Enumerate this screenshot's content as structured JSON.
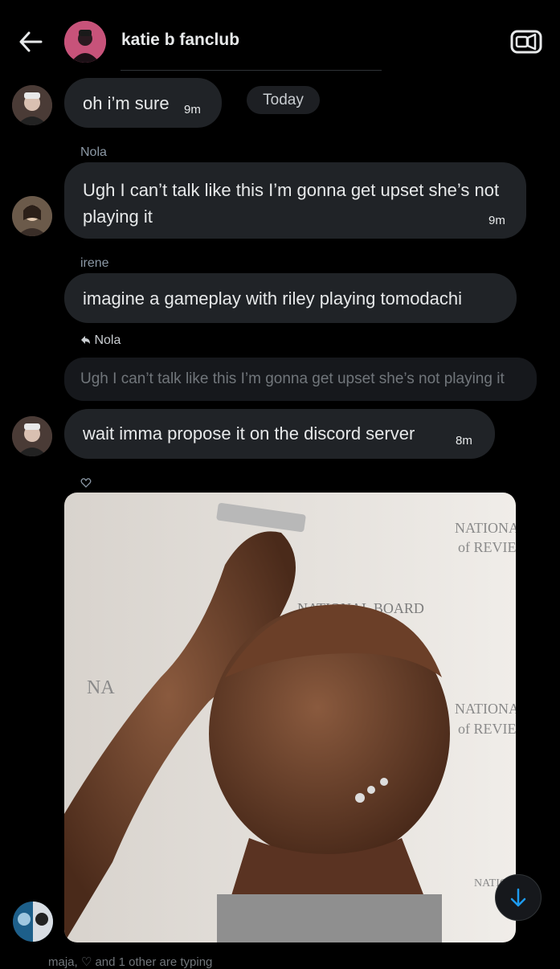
{
  "header": {
    "title": "katie b fanclub",
    "back_icon": "arrow-left-icon",
    "video_icon": "video-camera-icon"
  },
  "messages": [
    {
      "text": "oh i’m sure",
      "time": "9m"
    },
    {
      "sender": "Nola",
      "text": "Ugh I can’t talk like this I’m gonna get upset she’s not playing it",
      "time": "9m"
    },
    {
      "sender": "irene",
      "text": "imagine a gameplay with riley playing tomodachi"
    },
    {
      "reply_to": "Nola",
      "quoted": "Ugh I can’t talk like this I’m gonna get upset she’s not playing it",
      "text": "wait imma propose it on the discord server",
      "time": "8m"
    }
  ],
  "date_pill": "Today",
  "reaction_icon": "heart-outline-icon",
  "scroll_icon": "arrow-down-icon",
  "typing": {
    "text": "maja, ♡ and 1 other are typing"
  },
  "colors": {
    "background": "#000000",
    "bubble": "#202327",
    "accent": "#1d9bf0"
  }
}
